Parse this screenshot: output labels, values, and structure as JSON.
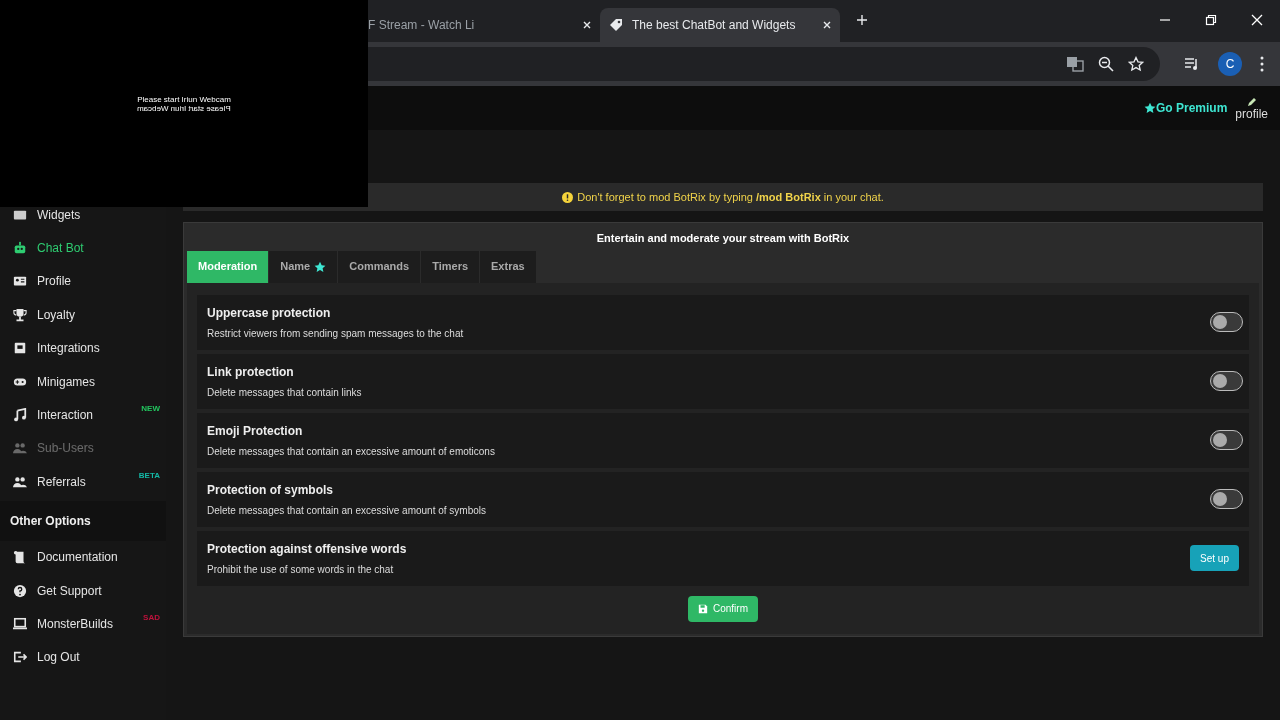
{
  "browser": {
    "tabs": [
      {
        "title": "F Stream - Watch Li",
        "selected": false
      },
      {
        "title": "The best ChatBot and Widgets",
        "selected": true
      }
    ],
    "profile_initial": "C"
  },
  "webcam_overlay": {
    "message": "Please start Iriun Webcam",
    "mirrored_message": "Please start Iriun Webcam"
  },
  "header": {
    "premium": "Go Premium",
    "profile": "profile"
  },
  "sidebar": {
    "items": [
      {
        "label": "Widgets",
        "selected": false,
        "disabled": false
      },
      {
        "label": "Chat Bot",
        "selected": true,
        "disabled": false
      },
      {
        "label": "Profile",
        "selected": false,
        "disabled": false
      },
      {
        "label": "Loyalty",
        "selected": false,
        "disabled": false
      },
      {
        "label": "Integrations",
        "selected": false,
        "disabled": false
      },
      {
        "label": "Minigames",
        "selected": false,
        "disabled": false
      },
      {
        "label": "Interaction",
        "selected": false,
        "disabled": false,
        "badge": "NEW",
        "color": "#22c55e"
      },
      {
        "label": "Sub-Users",
        "selected": false,
        "disabled": true
      },
      {
        "label": "Referrals",
        "selected": false,
        "disabled": false,
        "badge": "BETA",
        "color": "#14b8a6"
      }
    ],
    "section_title": "Other Options",
    "other_items": [
      {
        "label": "Documentation",
        "selected": false,
        "disabled": false
      },
      {
        "label": "Get Support",
        "selected": false,
        "disabled": false
      },
      {
        "label": "MonsterBuilds",
        "selected": false,
        "disabled": false,
        "badge": "SAD",
        "color": "#be123c"
      },
      {
        "label": "Log Out",
        "selected": false,
        "disabled": false
      }
    ]
  },
  "notice": "Don't forget to mod BotRix by typing **/mod BotRix** in your chat.",
  "panel": {
    "title": "Entertain and moderate your stream with BotRix",
    "tabs": [
      {
        "label": "Moderation",
        "selected": true,
        "starred": false
      },
      {
        "label": "Name",
        "selected": false,
        "starred": true
      },
      {
        "label": "Commands",
        "selected": false,
        "starred": false
      },
      {
        "label": "Timers",
        "selected": false,
        "starred": false
      },
      {
        "label": "Extras",
        "selected": false,
        "starred": false
      }
    ],
    "settings": [
      {
        "kind": "toggle",
        "title": "Uppercase protection",
        "description": "Restrict viewers from sending spam messages to the chat",
        "on": false
      },
      {
        "kind": "toggle",
        "title": "Link protection",
        "description": "Delete messages that contain links",
        "on": false
      },
      {
        "kind": "toggle",
        "title": "Emoji Protection",
        "description": "Delete messages that contain an excessive amount of emoticons",
        "on": false
      },
      {
        "kind": "toggle",
        "title": "Protection of symbols",
        "description": "Delete messages that contain an excessive amount of symbols",
        "on": false
      },
      {
        "kind": "button",
        "title": "Protection against offensive words",
        "description": "Prohibit the use of some words in the chat",
        "button": "Set up"
      }
    ],
    "confirm": "Confirm"
  }
}
